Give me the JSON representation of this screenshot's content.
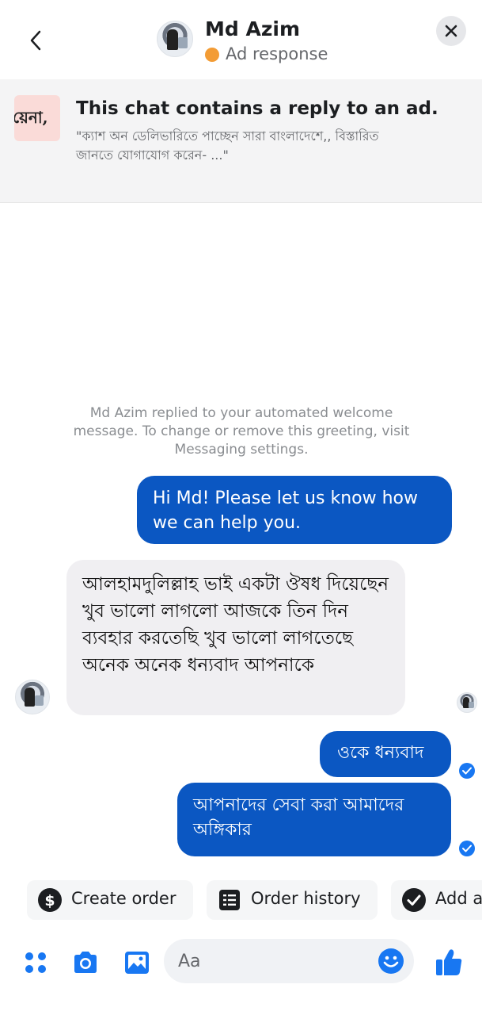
{
  "header": {
    "name": "Md Azim",
    "status": "Ad response"
  },
  "ad_banner": {
    "thumb_text": "য়েনা,",
    "title": "This chat contains a reply to an ad.",
    "quote": "\"ক্যাশ অন ডেলিভারিতে পাচ্ছেন সারা বাংলাদেশে,, বিস্তারিত জানতে যোগাযোগ করেন- ...\""
  },
  "conversation": {
    "system_note": "Md Azim replied to your automated welcome message. To change or remove this greeting, visit Messaging settings.",
    "messages": [
      {
        "side": "out",
        "text": "Hi Md! Please let us know how we can help you."
      },
      {
        "side": "in",
        "text": "আলহামদুলিল্লাহ ভাই একটা ঔষধ দিয়েছেন খুব ভালো লাগলো আজকে তিন দিন ব্যবহার করতেছি খুব ভালো লাগতেছে অনেক অনেক ধন্যবাদ আপনাকে"
      },
      {
        "side": "out",
        "text": "ওকে ধন্যবাদ"
      },
      {
        "side": "out",
        "text": "আপনাদের সেবা করা আমাদের অঙ্গিকার"
      }
    ]
  },
  "quick_replies": [
    {
      "label": "Create order",
      "icon": "dollar-icon"
    },
    {
      "label": "Order history",
      "icon": "list-icon"
    },
    {
      "label": "Add a",
      "icon": "check-circle-icon"
    }
  ],
  "composer": {
    "placeholder": "Aa"
  },
  "colors": {
    "accent": "#1877f2",
    "outgoing_bubble": "#0b57c2",
    "status_dot": "#f39c35"
  }
}
